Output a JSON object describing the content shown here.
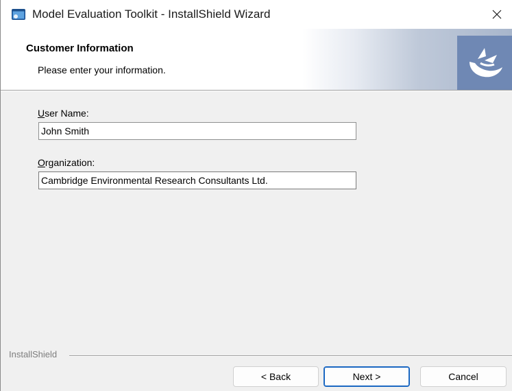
{
  "window": {
    "title": "Model Evaluation Toolkit - InstallShield Wizard",
    "close_glyph": "×"
  },
  "header": {
    "title": "Customer Information",
    "subtitle": "Please enter your information."
  },
  "form": {
    "user_name": {
      "label_accel": "U",
      "label_rest": "ser Name:",
      "value": "John Smith"
    },
    "organization": {
      "label_accel": "O",
      "label_rest": "rganization:",
      "value": "Cambridge Environmental Research Consultants Ltd."
    }
  },
  "footer": {
    "brand": "InstallShield",
    "back_label": "< Back",
    "next_label": "Next >",
    "cancel_label": "Cancel"
  },
  "colors": {
    "accent": "#1a67c2",
    "banner_logo": "#6f88b4",
    "window_bg": "#f0f0f0"
  },
  "icons": {
    "app": "installer-app-icon",
    "logo": "installshield-logo-icon",
    "close": "close-icon"
  }
}
